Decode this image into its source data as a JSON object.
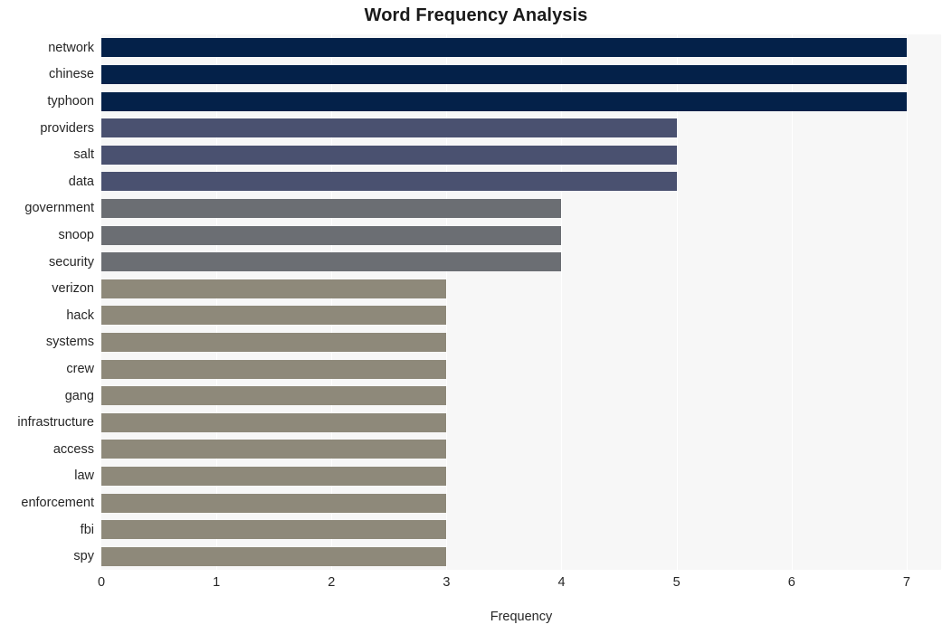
{
  "chart_data": {
    "type": "bar",
    "orientation": "horizontal",
    "title": "Word Frequency Analysis",
    "xlabel": "Frequency",
    "ylabel": "",
    "xlim": [
      0,
      7.3
    ],
    "xticks": [
      0,
      1,
      2,
      3,
      4,
      5,
      6,
      7
    ],
    "xtick_labels": [
      "0",
      "1",
      "2",
      "3",
      "4",
      "5",
      "6",
      "7"
    ],
    "grid": "vertical-white",
    "legend": "none",
    "plot_background": "#f7f7f7",
    "categories": [
      "network",
      "chinese",
      "typhoon",
      "providers",
      "salt",
      "data",
      "government",
      "snoop",
      "security",
      "verizon",
      "hack",
      "systems",
      "crew",
      "gang",
      "infrastructure",
      "access",
      "law",
      "enforcement",
      "fbi",
      "spy"
    ],
    "values": [
      7,
      7,
      7,
      5,
      5,
      5,
      4,
      4,
      4,
      3,
      3,
      3,
      3,
      3,
      3,
      3,
      3,
      3,
      3,
      3
    ],
    "bar_colors": [
      "#042149",
      "#042149",
      "#042149",
      "#4a5170",
      "#4a5170",
      "#4a5170",
      "#6b6e73",
      "#6b6e73",
      "#6b6e73",
      "#8e897a",
      "#8e897a",
      "#8e897a",
      "#8e897a",
      "#8e897a",
      "#8e897a",
      "#8e897a",
      "#8e897a",
      "#8e897a",
      "#8e897a",
      "#8e897a"
    ],
    "palette": {
      "dark_navy": "#042149",
      "slate_blue": "#4a5170",
      "gray": "#6b6e73",
      "khaki": "#8e897a"
    }
  }
}
